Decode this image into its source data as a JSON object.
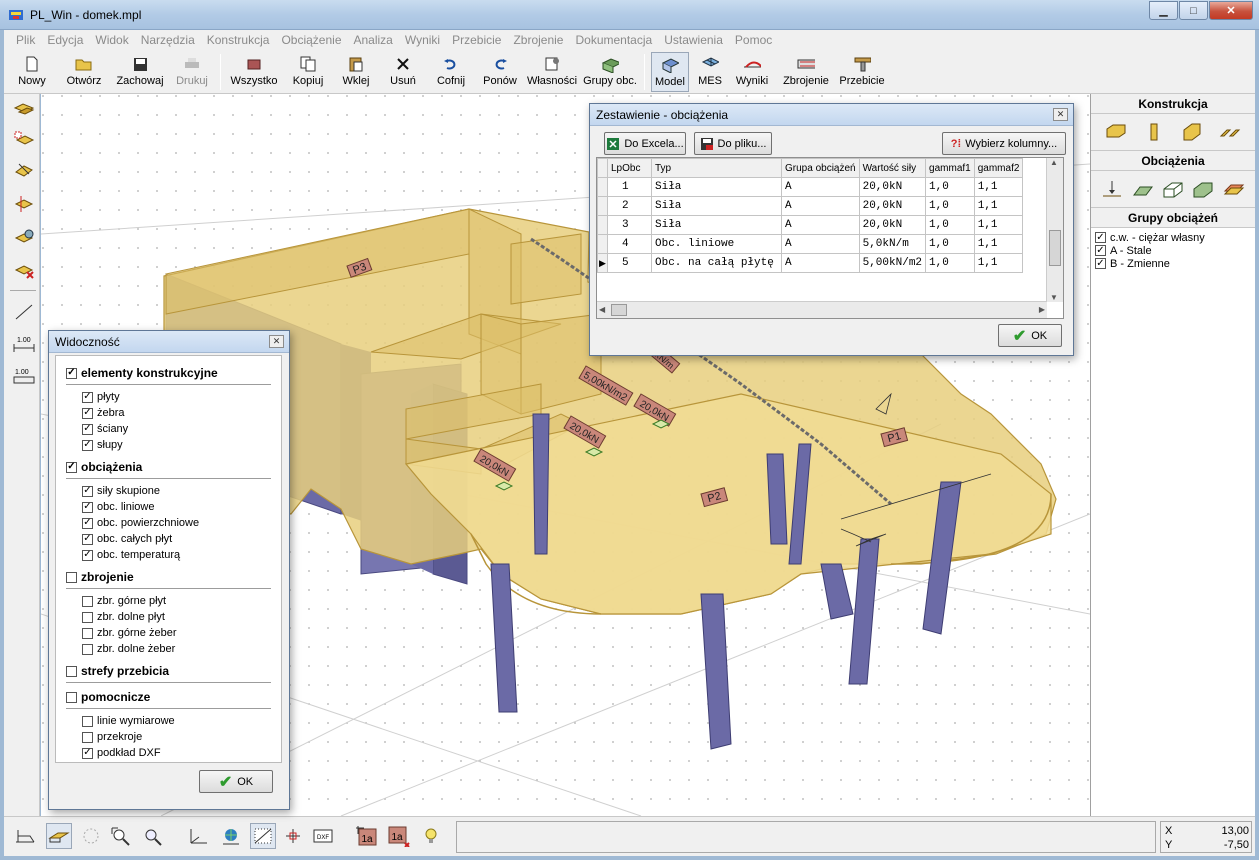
{
  "window": {
    "title": "PL_Win - domek.mpl",
    "minimize": "▁",
    "maximize": "□",
    "close": "✕"
  },
  "menu": [
    "Plik",
    "Edycja",
    "Widok",
    "Narzędzia",
    "Konstrukcja",
    "Obciążenie",
    "Analiza",
    "Wyniki",
    "Przebicie",
    "Zbrojenie",
    "Dokumentacja",
    "Ustawienia",
    "Pomoc"
  ],
  "menu_disabled": [
    "Plik",
    "Edycja",
    "Widok",
    "Narzędzia",
    "Konstrukcja",
    "Obciążenie",
    "Analiza",
    "Wyniki",
    "Przebicie",
    "Zbrojenie",
    "Dokumentacja",
    "Ustawienia",
    "Pomoc"
  ],
  "toolbar": {
    "new": "Nowy",
    "open": "Otwórz",
    "save": "Zachowaj",
    "print": "Drukuj",
    "all": "Wszystko",
    "copy": "Kopiuj",
    "paste": "Wklej",
    "delete": "Usuń",
    "undo": "Cofnij",
    "redo": "Ponów",
    "properties": "Własności",
    "groups": "Grupy obc.",
    "model": "Model",
    "mes": "MES",
    "results": "Wyniki",
    "reinforcement": "Zbrojenie",
    "punching": "Przebicie"
  },
  "right_panel": {
    "construction_header": "Konstrukcja",
    "loads_header": "Obciążenia",
    "groups_header": "Grupy obciążeń",
    "groups": [
      {
        "label": "c.w. - ciężar własny",
        "checked": true
      },
      {
        "label": "A - Stale",
        "checked": true
      },
      {
        "label": "B - Zmienne",
        "checked": true
      }
    ]
  },
  "visibility": {
    "title": "Widoczność",
    "sections": [
      {
        "label": "elementy konstrukcyjne",
        "checked": true,
        "items": [
          {
            "label": "płyty",
            "checked": true
          },
          {
            "label": "żebra",
            "checked": true
          },
          {
            "label": "ściany",
            "checked": true
          },
          {
            "label": "słupy",
            "checked": true
          }
        ]
      },
      {
        "label": "obciążenia",
        "checked": true,
        "items": [
          {
            "label": "siły skupione",
            "checked": true
          },
          {
            "label": "obc. liniowe",
            "checked": true
          },
          {
            "label": "obc. powierzchniowe",
            "checked": true
          },
          {
            "label": "obc. całych płyt",
            "checked": true
          },
          {
            "label": "obc. temperaturą",
            "checked": true
          }
        ]
      },
      {
        "label": "zbrojenie",
        "checked": false,
        "items": [
          {
            "label": "zbr. górne płyt",
            "checked": false
          },
          {
            "label": "zbr. dolne płyt",
            "checked": false
          },
          {
            "label": "zbr. górne żeber",
            "checked": false
          },
          {
            "label": "zbr. dolne żeber",
            "checked": false
          }
        ]
      },
      {
        "label": "strefy przebicia",
        "checked": false,
        "items": []
      },
      {
        "label": "pomocnicze",
        "checked": false,
        "items": [
          {
            "label": "linie wymiarowe",
            "checked": false
          },
          {
            "label": "przekroje",
            "checked": false
          },
          {
            "label": "podkład DXF",
            "checked": true
          }
        ]
      }
    ],
    "ok": "OK"
  },
  "loads_dialog": {
    "title": "Zestawienie - obciążenia",
    "to_excel": "Do Excela...",
    "to_file": "Do pliku...",
    "choose_columns": "Wybierz kolumny...",
    "columns": [
      "LpObc",
      "Typ",
      "Grupa obciążeń",
      "Wartość siły",
      "gammaf1",
      "gammaf2"
    ],
    "rows": [
      [
        "1",
        "Siła",
        "A",
        "20,0kN",
        "1,0",
        "1,1"
      ],
      [
        "2",
        "Siła",
        "A",
        "20,0kN",
        "1,0",
        "1,1"
      ],
      [
        "3",
        "Siła",
        "A",
        "20,0kN",
        "1,0",
        "1,1"
      ],
      [
        "4",
        "Obc. liniowe",
        "A",
        "5,0kN/m",
        "1,0",
        "1,1"
      ],
      [
        "5",
        "Obc. na całą płytę",
        "A",
        "5,00kN/m2",
        "1,0",
        "1,1"
      ]
    ],
    "current_row": 4,
    "ok": "OK"
  },
  "model_labels": {
    "plate_p1": "P1",
    "plate_p2": "P2",
    "plate_p3": "P3",
    "force1": "20,0kN",
    "force2": "20,0kN",
    "force3": "20,0kN",
    "surface_load": "5,00kN/m2",
    "line_load": "5,0kN/m"
  },
  "status": {
    "x_label": "X",
    "x_value": "13,00",
    "y_label": "Y",
    "y_value": "-7,50"
  },
  "colors": {
    "slab": "#e8cf7e",
    "wall": "#6b6aa6",
    "accent": "#2e9b2e"
  }
}
